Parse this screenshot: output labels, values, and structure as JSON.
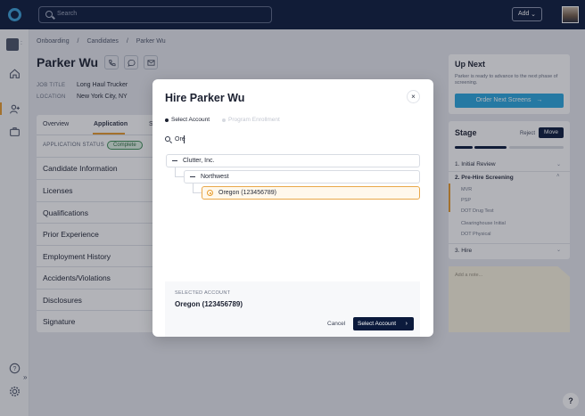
{
  "topbar": {
    "search_placeholder": "Search",
    "add_label": "Add",
    "add_chevron": "⌄"
  },
  "rail": {
    "colon": ":",
    "expand_glyph": "»"
  },
  "breadcrumb": [
    "Onboarding",
    "/",
    "Candidates",
    "/",
    "Parker Wu"
  ],
  "candidate": {
    "name": "Parker Wu",
    "job_title_label": "JOB TITLE",
    "job_title": "Long Haul Trucker",
    "location_label": "LOCATION",
    "location": "New York City, NY"
  },
  "tabs": {
    "overview": "Overview",
    "application": "Application",
    "s": "S"
  },
  "application_status": {
    "label": "APPLICATION STATUS",
    "badge": "Complete"
  },
  "sections": [
    "Candidate Information",
    "Licenses",
    "Qualifications",
    "Prior Experience",
    "Employment History",
    "Accidents/Violations",
    "Disclosures",
    "Signature"
  ],
  "up_next": {
    "title": "Up Next",
    "text": "Parker is ready to advance to the next phase of screening.",
    "button": "Order Next Screens",
    "button_arrow": "→"
  },
  "stage": {
    "title": "Stage",
    "reject": "Reject",
    "move": "Move",
    "progress_complete": 0.67,
    "stages": [
      "1. Initial Review",
      "2. Pre-Hire Screening",
      "3. Hire"
    ],
    "pre_hire_items": [
      "MVR",
      "PSP",
      "DOT Drug Test",
      "Clearinghouse Initial",
      "DOT Physical"
    ]
  },
  "note": {
    "placeholder": "Add a note..."
  },
  "help": "?",
  "modal": {
    "title": "Hire Parker Wu",
    "close": "×",
    "step1": "Select Account",
    "step2": "Program Enrollment",
    "search_value": "Ore",
    "tree": {
      "level1": "Clutter, Inc.",
      "level2": "Northwest",
      "level3": "Oregon (123456789)"
    },
    "selected_label": "SELECTED ACCOUNT",
    "selected_value": "Oregon (123456789)",
    "cancel": "Cancel",
    "confirm": "Select Account",
    "confirm_arrow": "›"
  },
  "colors": {
    "navy": "#0b1a3c",
    "accent": "#e89c2c",
    "primary_blue": "#29a8e0",
    "success": "#3e8d56"
  }
}
